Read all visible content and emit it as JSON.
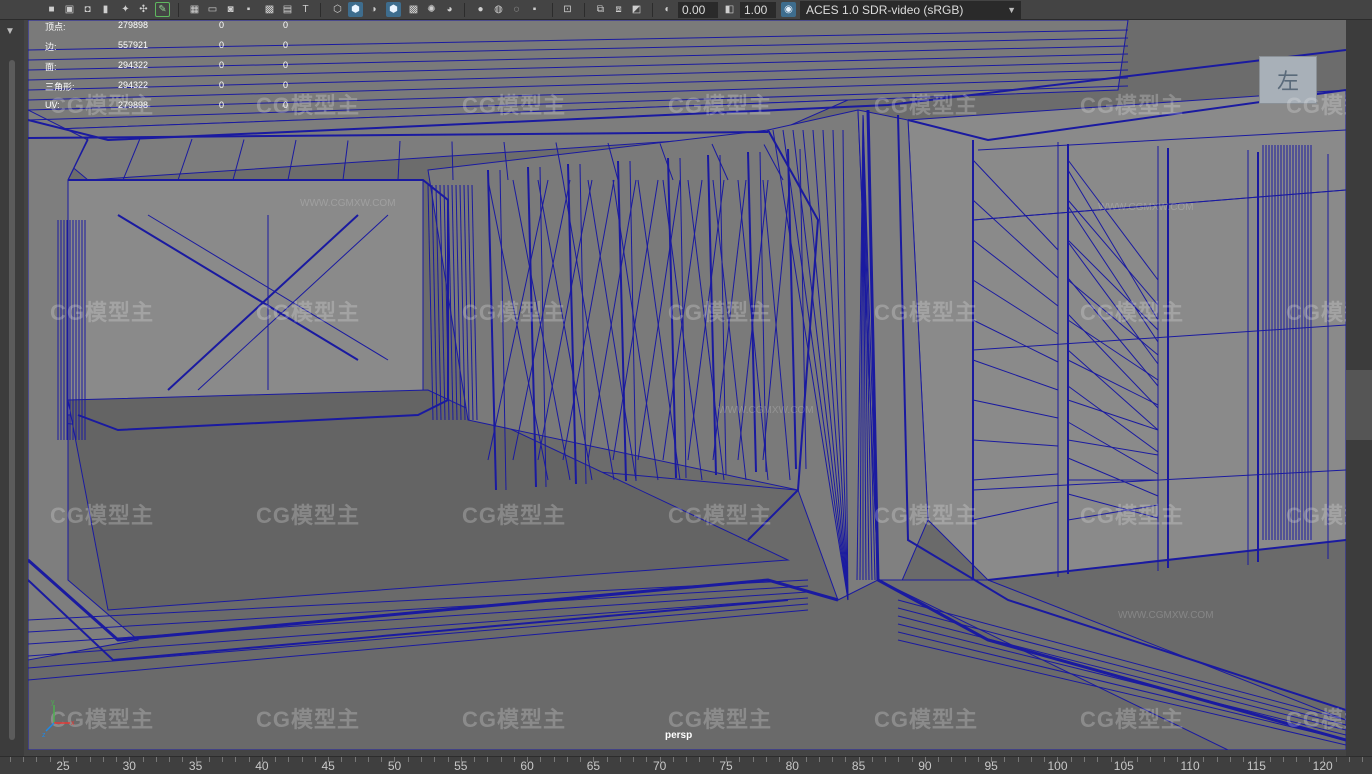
{
  "toolbar": {
    "exposure": "0.00",
    "gamma": "1.00",
    "color_space": "ACES 1.0 SDR-video (sRGB)"
  },
  "hud": {
    "rows": [
      {
        "label": "顶点:",
        "count": "279898",
        "sel": "0",
        "extra": "0"
      },
      {
        "label": "边:",
        "count": "557921",
        "sel": "0",
        "extra": "0"
      },
      {
        "label": "面:",
        "count": "294322",
        "sel": "0",
        "extra": "0"
      },
      {
        "label": "三角形:",
        "count": "294322",
        "sel": "0",
        "extra": "0"
      },
      {
        "label": "UV:",
        "count": "279898",
        "sel": "0",
        "extra": "0"
      }
    ]
  },
  "viewport": {
    "camera": "persp",
    "viewcube_face": "左",
    "watermark": "CG模型主",
    "watermark_url": "WWW.CGMXW.COM"
  },
  "timeline": {
    "ticks": [
      "25",
      "30",
      "35",
      "40",
      "45",
      "50",
      "55",
      "60",
      "65",
      "70",
      "75",
      "80",
      "85",
      "90",
      "95",
      "100",
      "105",
      "110",
      "115",
      "120"
    ]
  },
  "colors": {
    "wire": "#1a1aa0",
    "surface": "#6c6c6c",
    "ui_bg": "#444444",
    "highlight": "#3e6d8e"
  }
}
